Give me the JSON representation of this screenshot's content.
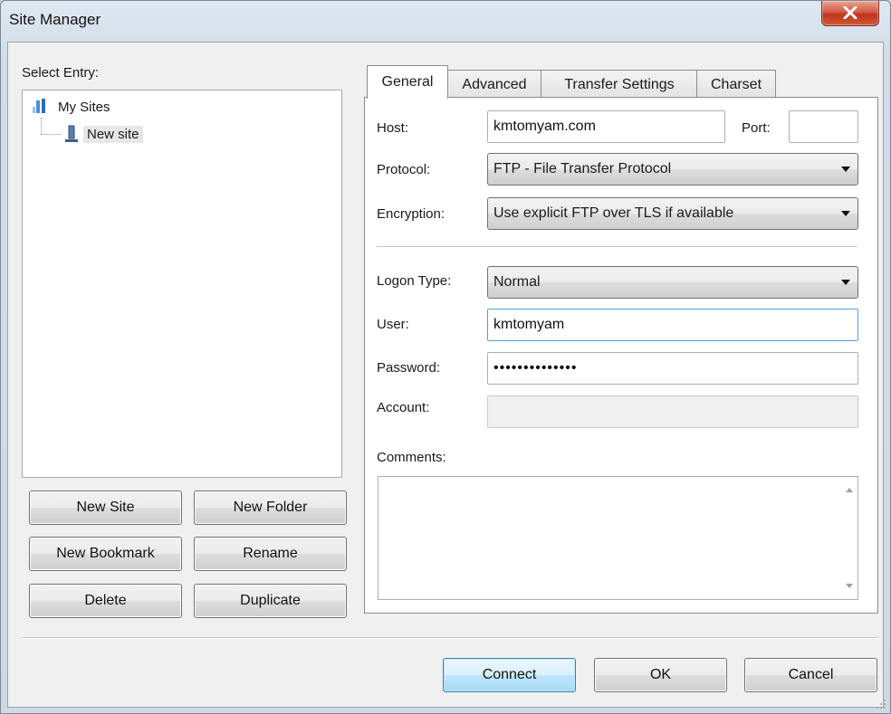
{
  "window": {
    "title": "Site Manager"
  },
  "left": {
    "select_entry_label": "Select Entry:",
    "tree": [
      {
        "label": "My Sites",
        "icon": "folder-icon"
      },
      {
        "label": "New site",
        "icon": "server-icon",
        "selected": true
      }
    ],
    "buttons": {
      "new_site": "New Site",
      "new_folder": "New Folder",
      "new_bookmark": "New Bookmark",
      "rename": "Rename",
      "delete": "Delete",
      "duplicate": "Duplicate"
    }
  },
  "tabs": [
    {
      "label": "General",
      "active": true
    },
    {
      "label": "Advanced"
    },
    {
      "label": "Transfer Settings"
    },
    {
      "label": "Charset"
    }
  ],
  "general": {
    "host_label": "Host:",
    "host_value": "kmtomyam.com",
    "port_label": "Port:",
    "port_value": "",
    "protocol_label": "Protocol:",
    "protocol_value": "FTP - File Transfer Protocol",
    "encryption_label": "Encryption:",
    "encryption_value": "Use explicit FTP over TLS if available",
    "logon_type_label": "Logon Type:",
    "logon_type_value": "Normal",
    "user_label": "User:",
    "user_value": "kmtomyam",
    "password_label": "Password:",
    "password_value": "••••••••••••••",
    "account_label": "Account:",
    "account_value": "",
    "comments_label": "Comments:",
    "comments_value": ""
  },
  "footer": {
    "connect": "Connect",
    "ok": "OK",
    "cancel": "Cancel"
  },
  "colors": {
    "close_button": "#c8432a",
    "primary_button": "#bee6fd",
    "focus_border": "#569de5"
  }
}
